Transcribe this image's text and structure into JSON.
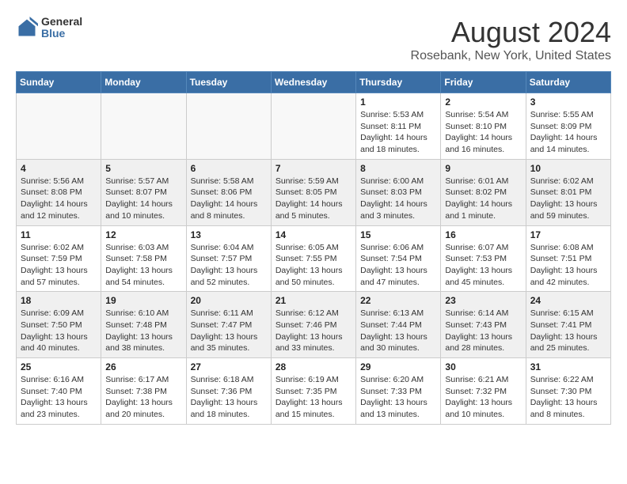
{
  "header": {
    "logo": {
      "general": "General",
      "blue": "Blue"
    },
    "title": "August 2024",
    "subtitle": "Rosebank, New York, United States"
  },
  "weekdays": [
    "Sunday",
    "Monday",
    "Tuesday",
    "Wednesday",
    "Thursday",
    "Friday",
    "Saturday"
  ],
  "weeks": [
    [
      {
        "day": "",
        "info": ""
      },
      {
        "day": "",
        "info": ""
      },
      {
        "day": "",
        "info": ""
      },
      {
        "day": "",
        "info": ""
      },
      {
        "day": "1",
        "info": "Sunrise: 5:53 AM\nSunset: 8:11 PM\nDaylight: 14 hours\nand 18 minutes."
      },
      {
        "day": "2",
        "info": "Sunrise: 5:54 AM\nSunset: 8:10 PM\nDaylight: 14 hours\nand 16 minutes."
      },
      {
        "day": "3",
        "info": "Sunrise: 5:55 AM\nSunset: 8:09 PM\nDaylight: 14 hours\nand 14 minutes."
      }
    ],
    [
      {
        "day": "4",
        "info": "Sunrise: 5:56 AM\nSunset: 8:08 PM\nDaylight: 14 hours\nand 12 minutes."
      },
      {
        "day": "5",
        "info": "Sunrise: 5:57 AM\nSunset: 8:07 PM\nDaylight: 14 hours\nand 10 minutes."
      },
      {
        "day": "6",
        "info": "Sunrise: 5:58 AM\nSunset: 8:06 PM\nDaylight: 14 hours\nand 8 minutes."
      },
      {
        "day": "7",
        "info": "Sunrise: 5:59 AM\nSunset: 8:05 PM\nDaylight: 14 hours\nand 5 minutes."
      },
      {
        "day": "8",
        "info": "Sunrise: 6:00 AM\nSunset: 8:03 PM\nDaylight: 14 hours\nand 3 minutes."
      },
      {
        "day": "9",
        "info": "Sunrise: 6:01 AM\nSunset: 8:02 PM\nDaylight: 14 hours\nand 1 minute."
      },
      {
        "day": "10",
        "info": "Sunrise: 6:02 AM\nSunset: 8:01 PM\nDaylight: 13 hours\nand 59 minutes."
      }
    ],
    [
      {
        "day": "11",
        "info": "Sunrise: 6:02 AM\nSunset: 7:59 PM\nDaylight: 13 hours\nand 57 minutes."
      },
      {
        "day": "12",
        "info": "Sunrise: 6:03 AM\nSunset: 7:58 PM\nDaylight: 13 hours\nand 54 minutes."
      },
      {
        "day": "13",
        "info": "Sunrise: 6:04 AM\nSunset: 7:57 PM\nDaylight: 13 hours\nand 52 minutes."
      },
      {
        "day": "14",
        "info": "Sunrise: 6:05 AM\nSunset: 7:55 PM\nDaylight: 13 hours\nand 50 minutes."
      },
      {
        "day": "15",
        "info": "Sunrise: 6:06 AM\nSunset: 7:54 PM\nDaylight: 13 hours\nand 47 minutes."
      },
      {
        "day": "16",
        "info": "Sunrise: 6:07 AM\nSunset: 7:53 PM\nDaylight: 13 hours\nand 45 minutes."
      },
      {
        "day": "17",
        "info": "Sunrise: 6:08 AM\nSunset: 7:51 PM\nDaylight: 13 hours\nand 42 minutes."
      }
    ],
    [
      {
        "day": "18",
        "info": "Sunrise: 6:09 AM\nSunset: 7:50 PM\nDaylight: 13 hours\nand 40 minutes."
      },
      {
        "day": "19",
        "info": "Sunrise: 6:10 AM\nSunset: 7:48 PM\nDaylight: 13 hours\nand 38 minutes."
      },
      {
        "day": "20",
        "info": "Sunrise: 6:11 AM\nSunset: 7:47 PM\nDaylight: 13 hours\nand 35 minutes."
      },
      {
        "day": "21",
        "info": "Sunrise: 6:12 AM\nSunset: 7:46 PM\nDaylight: 13 hours\nand 33 minutes."
      },
      {
        "day": "22",
        "info": "Sunrise: 6:13 AM\nSunset: 7:44 PM\nDaylight: 13 hours\nand 30 minutes."
      },
      {
        "day": "23",
        "info": "Sunrise: 6:14 AM\nSunset: 7:43 PM\nDaylight: 13 hours\nand 28 minutes."
      },
      {
        "day": "24",
        "info": "Sunrise: 6:15 AM\nSunset: 7:41 PM\nDaylight: 13 hours\nand 25 minutes."
      }
    ],
    [
      {
        "day": "25",
        "info": "Sunrise: 6:16 AM\nSunset: 7:40 PM\nDaylight: 13 hours\nand 23 minutes."
      },
      {
        "day": "26",
        "info": "Sunrise: 6:17 AM\nSunset: 7:38 PM\nDaylight: 13 hours\nand 20 minutes."
      },
      {
        "day": "27",
        "info": "Sunrise: 6:18 AM\nSunset: 7:36 PM\nDaylight: 13 hours\nand 18 minutes."
      },
      {
        "day": "28",
        "info": "Sunrise: 6:19 AM\nSunset: 7:35 PM\nDaylight: 13 hours\nand 15 minutes."
      },
      {
        "day": "29",
        "info": "Sunrise: 6:20 AM\nSunset: 7:33 PM\nDaylight: 13 hours\nand 13 minutes."
      },
      {
        "day": "30",
        "info": "Sunrise: 6:21 AM\nSunset: 7:32 PM\nDaylight: 13 hours\nand 10 minutes."
      },
      {
        "day": "31",
        "info": "Sunrise: 6:22 AM\nSunset: 7:30 PM\nDaylight: 13 hours\nand 8 minutes."
      }
    ]
  ]
}
